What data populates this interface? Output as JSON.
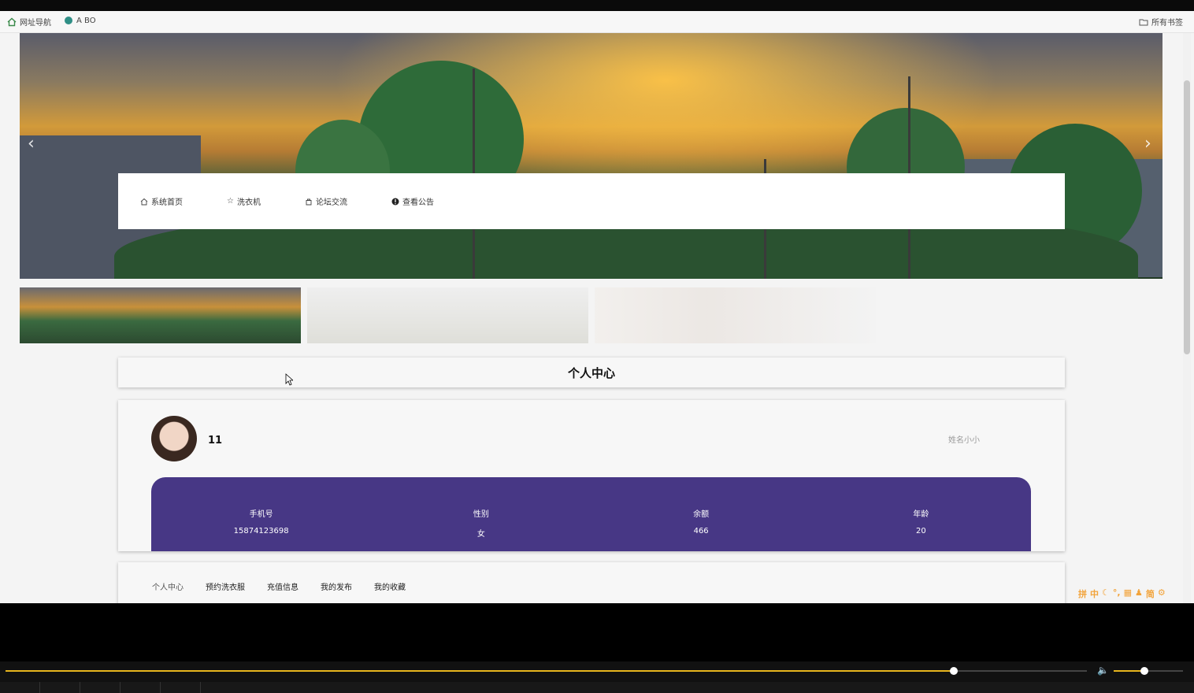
{
  "bookmarks": {
    "items": [
      {
        "label": "网址导航",
        "icon": "home-icon"
      },
      {
        "label": "A BO",
        "icon": "globe-icon"
      }
    ],
    "all_bookmarks": "所有书签"
  },
  "nav": {
    "items": [
      {
        "label": "系统首页",
        "icon": "home-outline-icon"
      },
      {
        "label": "洗衣机",
        "icon": "star-outline-icon"
      },
      {
        "label": "论坛交流",
        "icon": "bag-outline-icon"
      },
      {
        "label": "查看公告",
        "icon": "info-circle-icon"
      }
    ]
  },
  "section_title": "个人中心",
  "profile": {
    "username": "11",
    "nickname": "姓名小小",
    "stats": [
      {
        "label": "手机号",
        "value": "15874123698"
      },
      {
        "label": "性别",
        "value": "女"
      },
      {
        "label": "余额",
        "value": "466"
      },
      {
        "label": "年龄",
        "value": "20"
      }
    ],
    "stats_color": "#473785"
  },
  "tabs": [
    "个人中心",
    "预约洗衣服",
    "充值信息",
    "我的发布",
    "我的收藏"
  ],
  "ime": [
    "拼",
    "中",
    "☾",
    "°,",
    "▦",
    "♟",
    "简",
    "⚙"
  ],
  "player": {
    "progress": 0.877,
    "volume": 0.44,
    "accent": "#e7b51e"
  }
}
